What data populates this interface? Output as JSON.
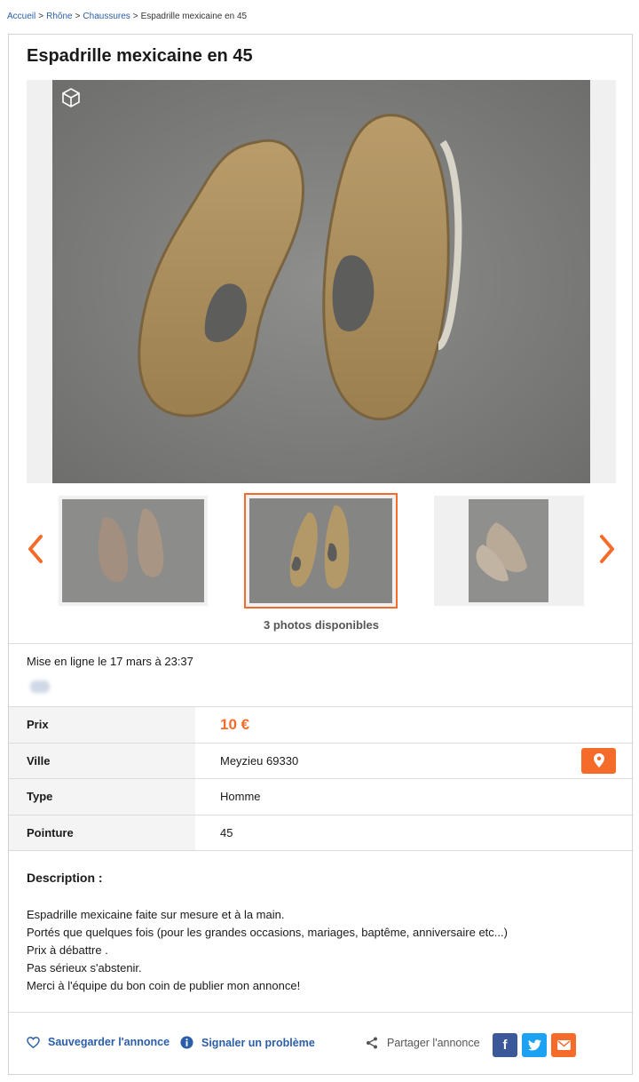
{
  "breadcrumb": {
    "items": [
      "Accueil",
      "Rhône",
      "Chaussures"
    ],
    "current": "Espadrille mexicaine en 45",
    "separator": ">"
  },
  "listing": {
    "title": "Espadrille mexicaine en 45",
    "photo_count_label": "3 photos disponibles",
    "selected_photo": 2,
    "posted": "Mise en ligne le 17 mars à 23:37"
  },
  "properties": [
    {
      "label": "Prix",
      "value": "10 €"
    },
    {
      "label": "Ville",
      "value": "Meyzieu 69330"
    },
    {
      "label": "Type",
      "value": "Homme"
    },
    {
      "label": "Pointure",
      "value": "45"
    }
  ],
  "description": {
    "heading": "Description :",
    "lines": [
      "Espadrille mexicaine faite sur mesure et à la main.",
      "Portés que quelques fois (pour les grandes occasions, mariages, baptême, anniversaire etc...)",
      "Prix à débattre .",
      "Pas sérieux s'abstenir.",
      "Merci à l'équipe du bon coin de publier mon annonce!"
    ]
  },
  "footer": {
    "save_label": "Sauvegarder l'annonce",
    "report_label": "Signaler un problème",
    "share_label": "Partager l'annonce",
    "share_buttons": [
      "f",
      "twitter-icon",
      "mail-icon"
    ]
  },
  "colors": {
    "accent": "#f56b2a",
    "link": "#2b5ea8",
    "facebook": "#3b5998",
    "twitter": "#1da1f2",
    "mail": "#f56b2a"
  }
}
